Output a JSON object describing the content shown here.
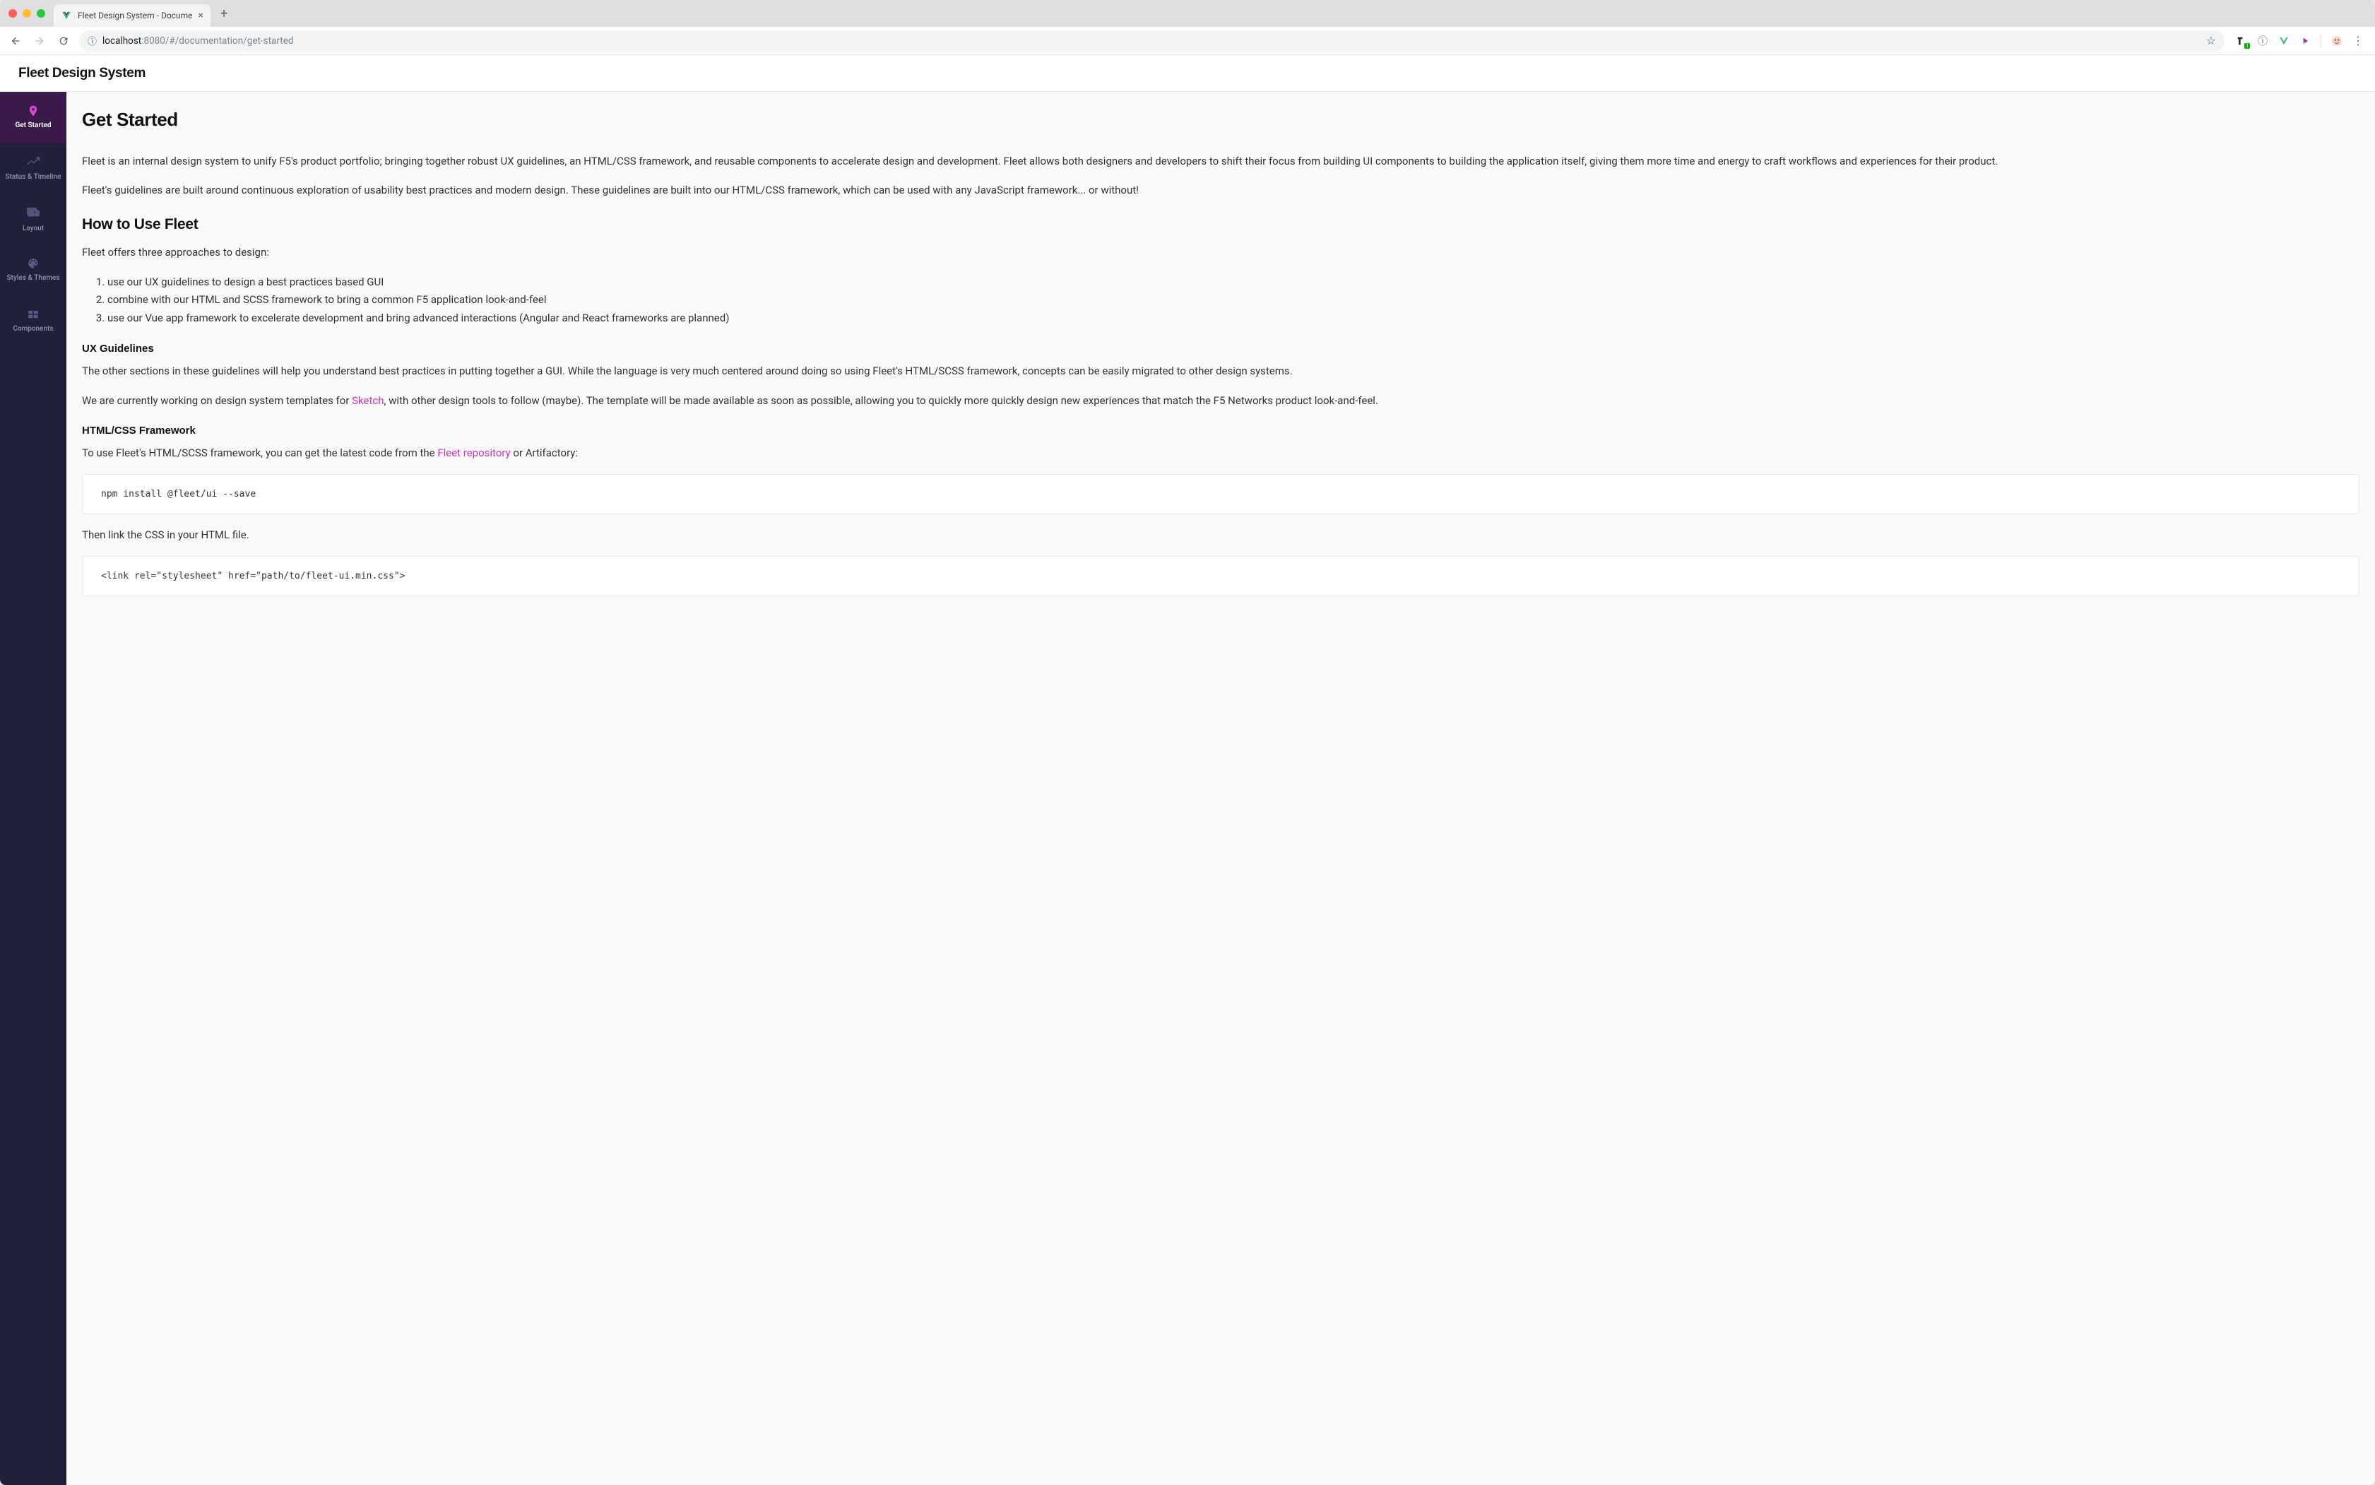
{
  "browser": {
    "tab_title": "Fleet Design System - Docume",
    "url": {
      "host": "localhost",
      "port": ":8080",
      "path": "/#/documentation/get-started"
    }
  },
  "app": {
    "title": "Fleet Design System"
  },
  "sidebar": {
    "items": [
      {
        "label": "Get Started",
        "icon": "map-pin-icon"
      },
      {
        "label": "Status & Timeline",
        "icon": "timeline-icon"
      },
      {
        "label": "Layout",
        "icon": "devices-icon"
      },
      {
        "label": "Styles & Themes",
        "icon": "palette-icon"
      },
      {
        "label": "Components",
        "icon": "grid-icon"
      }
    ]
  },
  "doc": {
    "title": "Get Started",
    "intro1": "Fleet is an internal design system to unify F5's product portfolio; bringing together robust UX guidelines, an HTML/CSS framework, and reusable components to accelerate design and development. Fleet allows both designers and developers to shift their focus from building UI components to building the application itself, giving them more time and energy to craft workflows and experiences for their product.",
    "intro2": "Fleet's guidelines are built around continuous exploration of usability best practices and modern design. These guidelines are built into our HTML/CSS framework, which can be used with any JavaScript framework... or without!",
    "how_heading": "How to Use Fleet",
    "how_intro": "Fleet offers three approaches to design:",
    "how_list": [
      "use our UX guidelines to design a best practices based GUI",
      "combine with our HTML and SCSS framework to bring a common F5 application look-and-feel",
      "use our Vue app framework to excelerate development and bring advanced interactions (Angular and React frameworks are planned)"
    ],
    "ux_heading": "UX Guidelines",
    "ux_p1": "The other sections in these guidelines will help you understand best practices in putting together a GUI. While the language is very much centered around doing so using Fleet's HTML/SCSS framework, concepts can be easily migrated to other design systems.",
    "ux_p2_pre": "We are currently working on design system templates for ",
    "ux_p2_link": "Sketch",
    "ux_p2_post": ", with other design tools to follow (maybe). The template will be made available as soon as possible, allowing you to quickly more quickly design new experiences that match the F5 Networks product look-and-feel.",
    "fw_heading": "HTML/CSS Framework",
    "fw_p_pre": "To use Fleet's HTML/SCSS framework, you can get the latest code from the ",
    "fw_p_link": "Fleet repository",
    "fw_p_post": " or Artifactory:",
    "code1": "npm install @fleet/ui --save",
    "link_p": "Then link the CSS in your HTML file.",
    "code2": "<link rel=\"stylesheet\" href=\"path/to/fleet-ui.min.css\">"
  }
}
